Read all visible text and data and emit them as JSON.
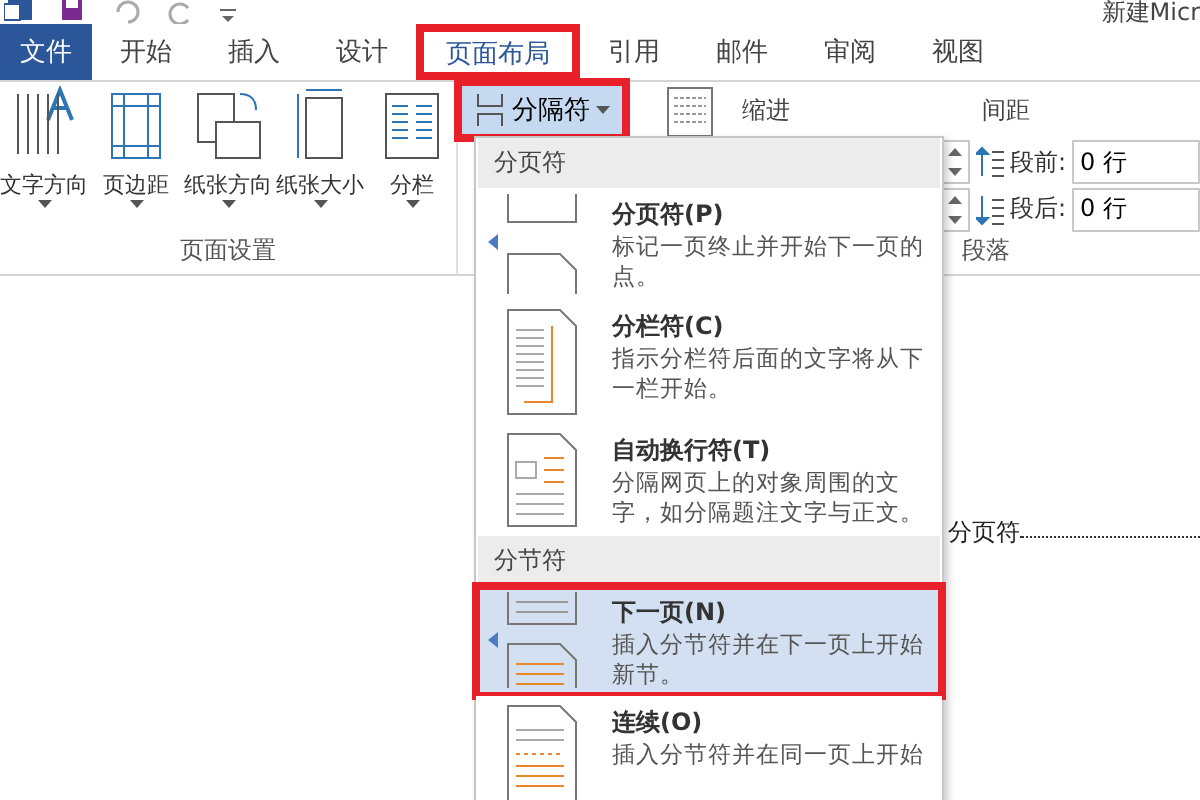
{
  "quick_access": {
    "title": "新建Micr"
  },
  "tabs": [
    {
      "label": "文件",
      "kind": "file",
      "selected": false,
      "highlighted": false
    },
    {
      "label": "开始",
      "kind": "tab",
      "selected": false,
      "highlighted": false
    },
    {
      "label": "插入",
      "kind": "tab",
      "selected": false,
      "highlighted": false
    },
    {
      "label": "设计",
      "kind": "tab",
      "selected": false,
      "highlighted": false
    },
    {
      "label": "页面布局",
      "kind": "tab",
      "selected": true,
      "highlighted": true
    },
    {
      "label": "引用",
      "kind": "tab",
      "selected": false,
      "highlighted": false
    },
    {
      "label": "邮件",
      "kind": "tab",
      "selected": false,
      "highlighted": false
    },
    {
      "label": "审阅",
      "kind": "tab",
      "selected": false,
      "highlighted": false
    },
    {
      "label": "视图",
      "kind": "tab",
      "selected": false,
      "highlighted": false
    }
  ],
  "ribbon": {
    "page_setup": {
      "label": "页面设置",
      "buttons": [
        {
          "label": "文字方向",
          "kind": "text-direction"
        },
        {
          "label": "页边距",
          "kind": "margins"
        },
        {
          "label": "纸张方向",
          "kind": "orientation"
        },
        {
          "label": "纸张大小",
          "kind": "size"
        },
        {
          "label": "分栏",
          "kind": "columns"
        }
      ]
    },
    "breaks_button": {
      "label": "分隔符",
      "expanded": true,
      "highlighted": true
    },
    "indent": {
      "label": "缩进"
    },
    "spacing": {
      "label": "间距",
      "rows": [
        {
          "label": "段前:",
          "value": "0 行",
          "kind": "before"
        },
        {
          "label": "段后:",
          "value": "0 行",
          "kind": "after"
        }
      ]
    },
    "paragraph_group": {
      "label": "段落"
    }
  },
  "document": {
    "break_label": "分页符"
  },
  "breaks_menu": {
    "sections": [
      {
        "title": "分页符",
        "items": [
          {
            "label": "分页符(P)",
            "description": "标记一页终止并开始下一页的点。",
            "kind": "page",
            "selected": false,
            "highlighted": false
          },
          {
            "label": "分栏符(C)",
            "description": "指示分栏符后面的文字将从下一栏开始。",
            "kind": "column",
            "selected": false,
            "highlighted": false
          },
          {
            "label": "自动换行符(T)",
            "description": "分隔网页上的对象周围的文字，如分隔题注文字与正文。",
            "kind": "wrap",
            "selected": false,
            "highlighted": false
          }
        ]
      },
      {
        "title": "分节符",
        "items": [
          {
            "label": "下一页(N)",
            "description": "插入分节符并在下一页上开始新节。",
            "kind": "next-page",
            "selected": true,
            "highlighted": true
          },
          {
            "label": "连续(O)",
            "description": "插入分节符并在同一页上开始",
            "kind": "continuous",
            "selected": false,
            "highlighted": false
          }
        ]
      }
    ]
  }
}
